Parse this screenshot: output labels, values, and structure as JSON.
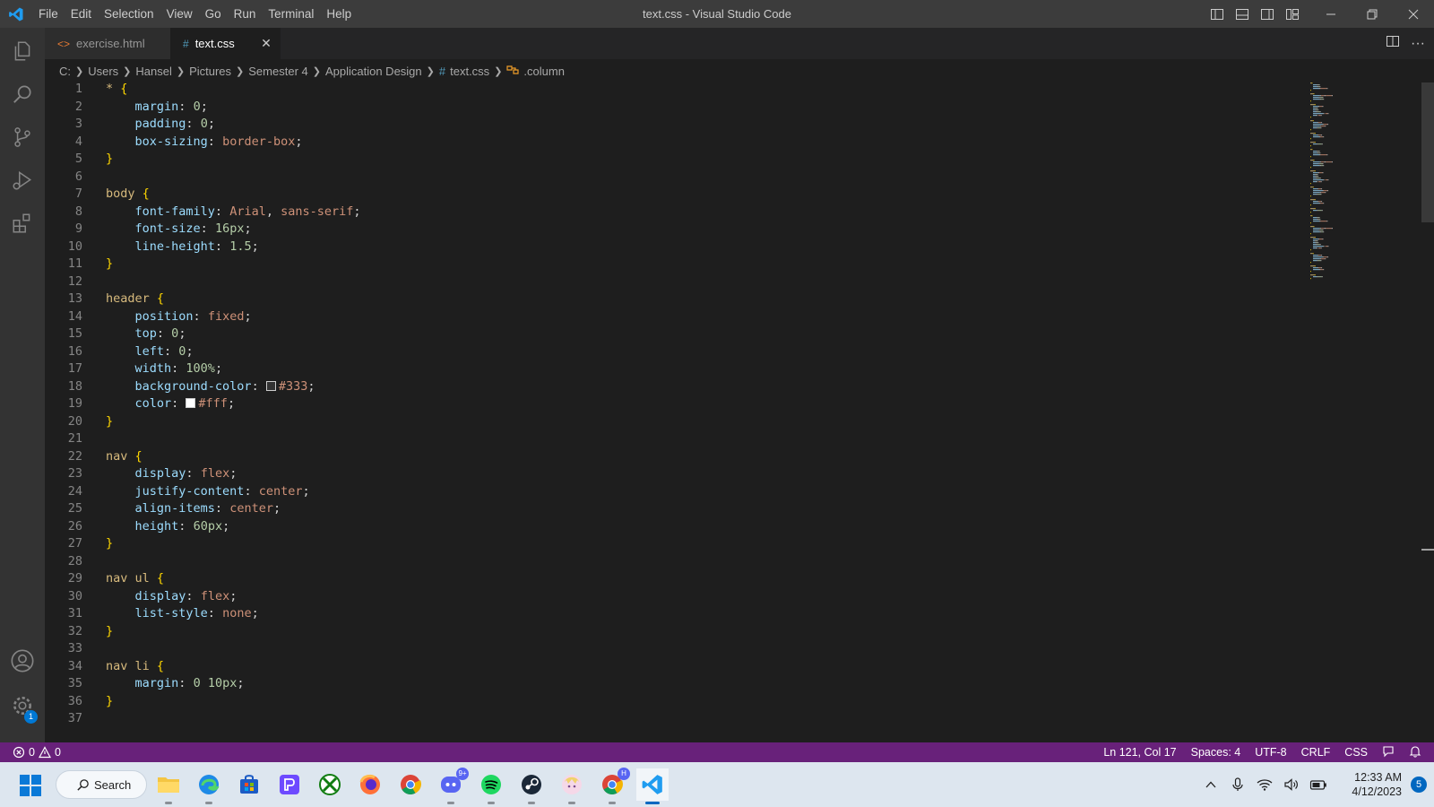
{
  "titlebar": {
    "window_title": "text.css - Visual Studio Code",
    "menu": [
      "File",
      "Edit",
      "Selection",
      "View",
      "Go",
      "Run",
      "Terminal",
      "Help"
    ]
  },
  "activitybar": {
    "items": [
      "explorer-icon",
      "search-icon",
      "source-control-icon",
      "run-debug-icon",
      "extensions-icon"
    ],
    "bottom": [
      "account-icon",
      "settings-gear-icon"
    ],
    "settings_badge": "1"
  },
  "tabs": [
    {
      "label": "exercise.html",
      "icon": "<>",
      "active": false
    },
    {
      "label": "text.css",
      "icon": "#",
      "active": true
    }
  ],
  "breadcrumb": {
    "parts": [
      "C:",
      "Users",
      "Hansel",
      "Pictures",
      "Semester 4",
      "Application Design"
    ],
    "file": "text.css",
    "file_icon": "#",
    "symbol": ".column"
  },
  "editor": {
    "language": "css",
    "lines": [
      [
        {
          "t": "sel",
          "v": "* "
        },
        {
          "t": "brace",
          "v": "{"
        }
      ],
      [
        {
          "t": "indent",
          "v": "    "
        },
        {
          "t": "prop",
          "v": "margin"
        },
        {
          "t": "punc",
          "v": ": "
        },
        {
          "t": "num",
          "v": "0"
        },
        {
          "t": "punc",
          "v": ";"
        }
      ],
      [
        {
          "t": "indent",
          "v": "    "
        },
        {
          "t": "prop",
          "v": "padding"
        },
        {
          "t": "punc",
          "v": ": "
        },
        {
          "t": "num",
          "v": "0"
        },
        {
          "t": "punc",
          "v": ";"
        }
      ],
      [
        {
          "t": "indent",
          "v": "    "
        },
        {
          "t": "prop",
          "v": "box-sizing"
        },
        {
          "t": "punc",
          "v": ": "
        },
        {
          "t": "val",
          "v": "border-box"
        },
        {
          "t": "punc",
          "v": ";"
        }
      ],
      [
        {
          "t": "brace",
          "v": "}"
        }
      ],
      [],
      [
        {
          "t": "sel",
          "v": "body "
        },
        {
          "t": "brace",
          "v": "{"
        }
      ],
      [
        {
          "t": "indent",
          "v": "    "
        },
        {
          "t": "prop",
          "v": "font-family"
        },
        {
          "t": "punc",
          "v": ": "
        },
        {
          "t": "val",
          "v": "Arial"
        },
        {
          "t": "punc",
          "v": ", "
        },
        {
          "t": "val",
          "v": "sans-serif"
        },
        {
          "t": "punc",
          "v": ";"
        }
      ],
      [
        {
          "t": "indent",
          "v": "    "
        },
        {
          "t": "prop",
          "v": "font-size"
        },
        {
          "t": "punc",
          "v": ": "
        },
        {
          "t": "num",
          "v": "16px"
        },
        {
          "t": "punc",
          "v": ";"
        }
      ],
      [
        {
          "t": "indent",
          "v": "    "
        },
        {
          "t": "prop",
          "v": "line-height"
        },
        {
          "t": "punc",
          "v": ": "
        },
        {
          "t": "num",
          "v": "1.5"
        },
        {
          "t": "punc",
          "v": ";"
        }
      ],
      [
        {
          "t": "brace",
          "v": "}"
        }
      ],
      [],
      [
        {
          "t": "sel",
          "v": "header "
        },
        {
          "t": "brace",
          "v": "{"
        }
      ],
      [
        {
          "t": "indent",
          "v": "    "
        },
        {
          "t": "prop",
          "v": "position"
        },
        {
          "t": "punc",
          "v": ": "
        },
        {
          "t": "val",
          "v": "fixed"
        },
        {
          "t": "punc",
          "v": ";"
        }
      ],
      [
        {
          "t": "indent",
          "v": "    "
        },
        {
          "t": "prop",
          "v": "top"
        },
        {
          "t": "punc",
          "v": ": "
        },
        {
          "t": "num",
          "v": "0"
        },
        {
          "t": "punc",
          "v": ";"
        }
      ],
      [
        {
          "t": "indent",
          "v": "    "
        },
        {
          "t": "prop",
          "v": "left"
        },
        {
          "t": "punc",
          "v": ": "
        },
        {
          "t": "num",
          "v": "0"
        },
        {
          "t": "punc",
          "v": ";"
        }
      ],
      [
        {
          "t": "indent",
          "v": "    "
        },
        {
          "t": "prop",
          "v": "width"
        },
        {
          "t": "punc",
          "v": ": "
        },
        {
          "t": "num",
          "v": "100%"
        },
        {
          "t": "punc",
          "v": ";"
        }
      ],
      [
        {
          "t": "indent",
          "v": "    "
        },
        {
          "t": "prop",
          "v": "background-color"
        },
        {
          "t": "punc",
          "v": ": "
        },
        {
          "t": "swatch",
          "v": "#333333"
        },
        {
          "t": "val",
          "v": "#333"
        },
        {
          "t": "punc",
          "v": ";"
        }
      ],
      [
        {
          "t": "indent",
          "v": "    "
        },
        {
          "t": "prop",
          "v": "color"
        },
        {
          "t": "punc",
          "v": ": "
        },
        {
          "t": "swatch",
          "v": "#ffffff"
        },
        {
          "t": "val",
          "v": "#fff"
        },
        {
          "t": "punc",
          "v": ";"
        }
      ],
      [
        {
          "t": "brace",
          "v": "}"
        }
      ],
      [],
      [
        {
          "t": "sel",
          "v": "nav "
        },
        {
          "t": "brace",
          "v": "{"
        }
      ],
      [
        {
          "t": "indent",
          "v": "    "
        },
        {
          "t": "prop",
          "v": "display"
        },
        {
          "t": "punc",
          "v": ": "
        },
        {
          "t": "val",
          "v": "flex"
        },
        {
          "t": "punc",
          "v": ";"
        }
      ],
      [
        {
          "t": "indent",
          "v": "    "
        },
        {
          "t": "prop",
          "v": "justify-content"
        },
        {
          "t": "punc",
          "v": ": "
        },
        {
          "t": "val",
          "v": "center"
        },
        {
          "t": "punc",
          "v": ";"
        }
      ],
      [
        {
          "t": "indent",
          "v": "    "
        },
        {
          "t": "prop",
          "v": "align-items"
        },
        {
          "t": "punc",
          "v": ": "
        },
        {
          "t": "val",
          "v": "center"
        },
        {
          "t": "punc",
          "v": ";"
        }
      ],
      [
        {
          "t": "indent",
          "v": "    "
        },
        {
          "t": "prop",
          "v": "height"
        },
        {
          "t": "punc",
          "v": ": "
        },
        {
          "t": "num",
          "v": "60px"
        },
        {
          "t": "punc",
          "v": ";"
        }
      ],
      [
        {
          "t": "brace",
          "v": "}"
        }
      ],
      [],
      [
        {
          "t": "sel",
          "v": "nav ul "
        },
        {
          "t": "brace",
          "v": "{"
        }
      ],
      [
        {
          "t": "indent",
          "v": "    "
        },
        {
          "t": "prop",
          "v": "display"
        },
        {
          "t": "punc",
          "v": ": "
        },
        {
          "t": "val",
          "v": "flex"
        },
        {
          "t": "punc",
          "v": ";"
        }
      ],
      [
        {
          "t": "indent",
          "v": "    "
        },
        {
          "t": "prop",
          "v": "list-style"
        },
        {
          "t": "punc",
          "v": ": "
        },
        {
          "t": "val",
          "v": "none"
        },
        {
          "t": "punc",
          "v": ";"
        }
      ],
      [
        {
          "t": "brace",
          "v": "}"
        }
      ],
      [],
      [
        {
          "t": "sel",
          "v": "nav li "
        },
        {
          "t": "brace",
          "v": "{"
        }
      ],
      [
        {
          "t": "indent",
          "v": "    "
        },
        {
          "t": "prop",
          "v": "margin"
        },
        {
          "t": "punc",
          "v": ": "
        },
        {
          "t": "num",
          "v": "0 10px"
        },
        {
          "t": "punc",
          "v": ";"
        }
      ],
      [
        {
          "t": "brace",
          "v": "}"
        }
      ],
      []
    ]
  },
  "statusbar": {
    "errors": "0",
    "warnings": "0",
    "cursor": "Ln 121, Col 17",
    "indent": "Spaces: 4",
    "encoding": "UTF-8",
    "eol": "CRLF",
    "language": "CSS"
  },
  "taskbar": {
    "search_label": "Search",
    "apps": [
      {
        "name": "file-explorer-icon",
        "running": true
      },
      {
        "name": "edge-icon",
        "running": true
      },
      {
        "name": "store-icon",
        "running": false
      },
      {
        "name": "proton-vpn-icon",
        "running": false
      },
      {
        "name": "xbox-icon",
        "running": false
      },
      {
        "name": "firefox-icon",
        "running": false
      },
      {
        "name": "chrome-icon",
        "running": false
      },
      {
        "name": "discord-icon",
        "running": true,
        "badge": "9+"
      },
      {
        "name": "spotify-icon",
        "running": true
      },
      {
        "name": "steam-icon",
        "running": true
      },
      {
        "name": "anime-app-icon",
        "running": true
      },
      {
        "name": "chrome-profile-icon",
        "running": true,
        "badge": "H"
      },
      {
        "name": "vscode-icon",
        "running": true,
        "active": true
      }
    ],
    "tray": [
      "chevron-up-icon",
      "microphone-icon",
      "wifi-icon",
      "volume-icon",
      "battery-icon"
    ],
    "time": "12:33 AM",
    "date": "4/12/2023",
    "notification_count": "5"
  },
  "colors": {
    "titlebar": "#3c3c3c",
    "activitybar": "#333333",
    "editor_bg": "#1e1e1e",
    "statusbar": "#68217a",
    "taskbar": "#dde6ef"
  }
}
